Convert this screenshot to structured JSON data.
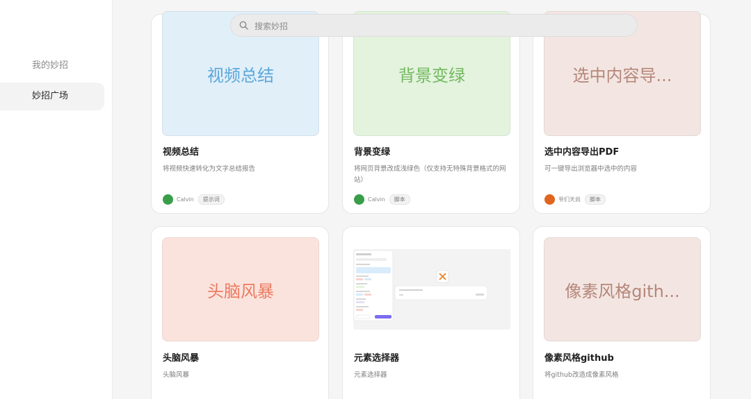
{
  "sidebar": {
    "items": [
      {
        "label": "我的妙招",
        "active": false
      },
      {
        "label": "妙招广场",
        "active": true
      }
    ]
  },
  "search": {
    "placeholder": "搜索妙招",
    "icon": "search-icon"
  },
  "cards": [
    {
      "thumb_text": "视频总结",
      "thumb_bg": "#e1eff9",
      "thumb_fg": "#5ba7d9",
      "title": "视频总结",
      "desc": "将视频快速转化为文字总结报告",
      "author": "Calvin",
      "tag": "提示词",
      "avatar_color": "#3a9d4a"
    },
    {
      "thumb_text": "背景变绿",
      "thumb_bg": "#e3f3dd",
      "thumb_fg": "#73b960",
      "title": "背景变绿",
      "desc": "将网页背景改成浅绿色（仅支持无特殊背景格式的网站）",
      "author": "Calvin",
      "tag": "脚本",
      "avatar_color": "#3a9d4a"
    },
    {
      "thumb_text": "选中内容导...",
      "thumb_bg": "#f3e6e2",
      "thumb_fg": "#b5867a",
      "title": "选中内容导出PDF",
      "desc": "可一键导出浏览器中选中的内容",
      "author": "爷们天尚",
      "tag": "脚本",
      "avatar_color": "#e0651e"
    },
    {
      "thumb_text": "头脑风暴",
      "thumb_bg": "#fbe3dd",
      "thumb_fg": "#ec7a60",
      "title": "头脑风暴",
      "desc": "头脑风暴"
    },
    {
      "thumb_text": "",
      "thumb_bg": "#f3f3f3",
      "thumb_fg": "#999999",
      "title": "元素选择器",
      "desc": "元素选择器"
    },
    {
      "thumb_text": "像素风格gith...",
      "thumb_bg": "#f3e6e2",
      "thumb_fg": "#b5867a",
      "title": "像素风格github",
      "desc": "将github改造成像素风格"
    }
  ]
}
